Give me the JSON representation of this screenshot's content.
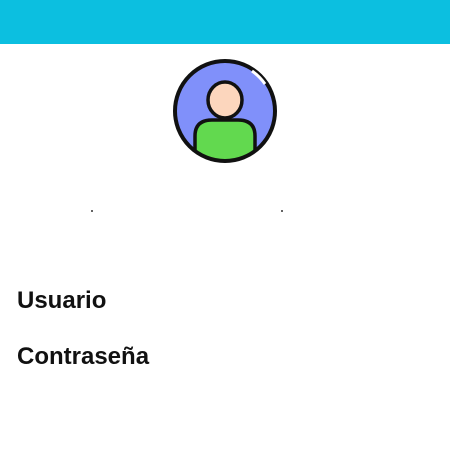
{
  "header": {
    "color": "#0cbfe0"
  },
  "avatar": {
    "icon": "user-avatar-icon",
    "colors": {
      "background": "#8090fa",
      "shirt": "#62d94f",
      "face": "#fcd6bd",
      "outline": "#111111"
    }
  },
  "form": {
    "username_label": "Usuario",
    "password_label": "Contraseña"
  }
}
